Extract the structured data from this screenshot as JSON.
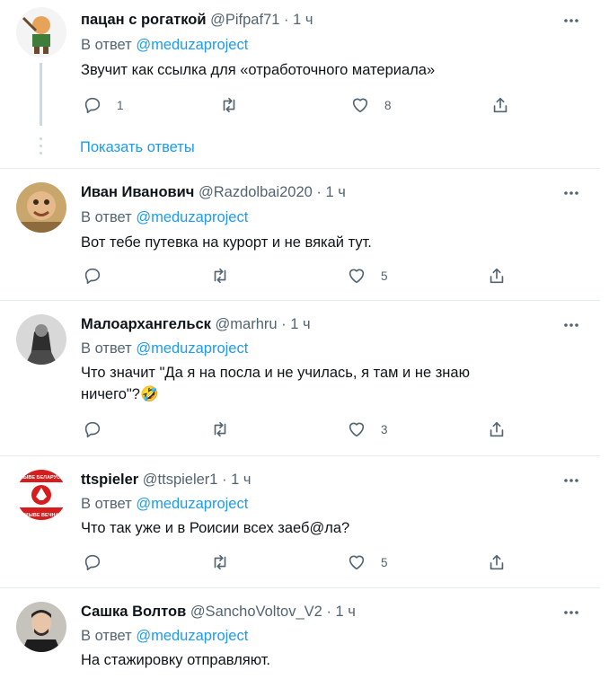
{
  "tweets": [
    {
      "name": "пацан с рогаткой",
      "handle": "@Pifpaf71",
      "dot": "·",
      "time": "1 ч",
      "reply_prefix": "В ответ",
      "reply_to": "@meduzaproject",
      "text": "Звучит как ссылка для «отработочного материала»",
      "replies": "1",
      "retweets": "",
      "likes": "8"
    },
    {
      "name": "Иван Иванович",
      "handle": "@Razdolbai2020",
      "dot": "·",
      "time": "1 ч",
      "reply_prefix": "В ответ",
      "reply_to": "@meduzaproject",
      "text": "Вот тебе путевка на курорт и не вякай тут.",
      "replies": "",
      "retweets": "",
      "likes": "5"
    },
    {
      "name": "Малоархангельск",
      "handle": "@marhru",
      "dot": "·",
      "time": "1 ч",
      "reply_prefix": "В ответ",
      "reply_to": "@meduzaproject",
      "text": "Что значит \"Да я на посла и не училась, я там и не знаю ничего\"?🤣",
      "replies": "",
      "retweets": "",
      "likes": "3"
    },
    {
      "name": "ttspieler",
      "handle": "@ttspieler1",
      "dot": "·",
      "time": "1 ч",
      "reply_prefix": "В ответ",
      "reply_to": "@meduzaproject",
      "text": "Что так уже и в Роисии всех заеб@ла?",
      "replies": "",
      "retweets": "",
      "likes": "5",
      "avatar_text_top": "ЖЫВЕ БЕЛАРУСЬ",
      "avatar_text_bottom": "ЖЫВЕ ВЕЧНА"
    },
    {
      "name": "Сашка Волтов",
      "handle": "@SanchoVoltov_V2",
      "dot": "·",
      "time": "1 ч",
      "reply_prefix": "В ответ",
      "reply_to": "@meduzaproject",
      "text": "На стажировку отправляют."
    }
  ],
  "show_replies": "Показать ответы",
  "colors": {
    "accent": "#1d9bf0",
    "muted": "#536471",
    "border": "#e6ecf0"
  },
  "icons": [
    "reply-icon",
    "retweet-icon",
    "like-icon",
    "share-icon",
    "more-icon"
  ]
}
